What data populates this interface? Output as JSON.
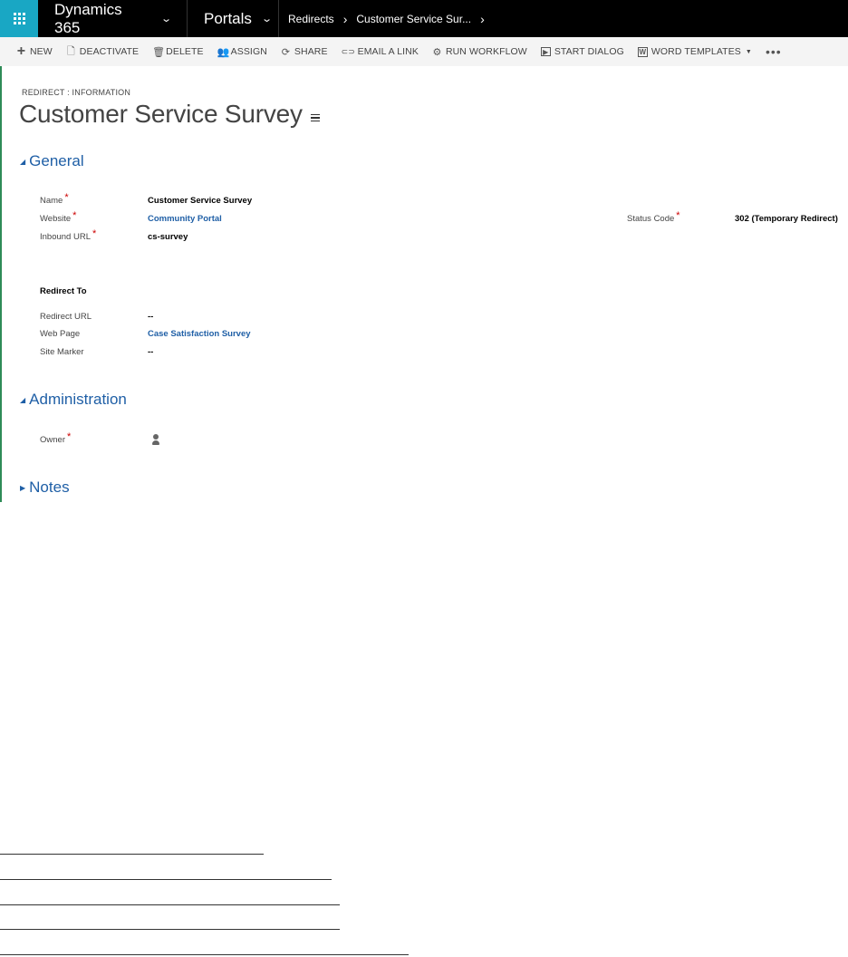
{
  "topnav": {
    "app_name": "Dynamics 365",
    "area_name": "Portals",
    "breadcrumb": [
      "Redirects",
      "Customer Service Sur..."
    ],
    "chevron": "⌄",
    "crumb_sep": "›"
  },
  "commands": [
    {
      "name": "new",
      "icon": "plus-icon",
      "glyph": "+",
      "label": "NEW"
    },
    {
      "name": "deactivate",
      "icon": "deactivate-icon",
      "glyph": "🗋",
      "label": "DEACTIVATE"
    },
    {
      "name": "delete",
      "icon": "trash-icon",
      "glyph": "🗑",
      "label": "DELETE"
    },
    {
      "name": "assign",
      "icon": "assign-icon",
      "glyph": "👥",
      "label": "ASSIGN"
    },
    {
      "name": "share",
      "icon": "share-icon",
      "glyph": "⟳",
      "label": "SHARE"
    },
    {
      "name": "email-link",
      "icon": "link-icon",
      "glyph": "⊂⊃",
      "label": "EMAIL A LINK"
    },
    {
      "name": "run-workflow",
      "icon": "workflow-icon",
      "glyph": "⚙",
      "label": "RUN WORKFLOW"
    },
    {
      "name": "start-dialog",
      "icon": "dialog-icon",
      "glyph": "▶",
      "label": "START DIALOG"
    },
    {
      "name": "word-templates",
      "icon": "word-icon",
      "glyph": "W",
      "label": "WORD TEMPLATES"
    }
  ],
  "more_glyph": "•••",
  "header": {
    "entity_label": "REDIRECT : INFORMATION",
    "title": "Customer Service Survey"
  },
  "sections": {
    "general": "General",
    "administration": "Administration",
    "notes": "Notes"
  },
  "general": {
    "name_label": "Name",
    "name_value": "Customer Service Survey",
    "website_label": "Website",
    "website_value": "Community Portal",
    "inbound_label": "Inbound URL",
    "inbound_value": "cs-survey",
    "status_label": "Status Code",
    "status_value": "302 (Temporary Redirect)",
    "required_mark": "*"
  },
  "redirect_to": {
    "heading": "Redirect To",
    "redirect_url_label": "Redirect URL",
    "redirect_url_value": "--",
    "web_page_label": "Web Page",
    "web_page_value": "Case Satisfaction Survey",
    "site_marker_label": "Site Marker",
    "site_marker_value": "--"
  },
  "administration": {
    "owner_label": "Owner"
  },
  "colors": {
    "waffle": "#19a7c4",
    "link": "#1f5fa6",
    "required": "#cc0000",
    "accent_bar": "#2e8b57"
  }
}
